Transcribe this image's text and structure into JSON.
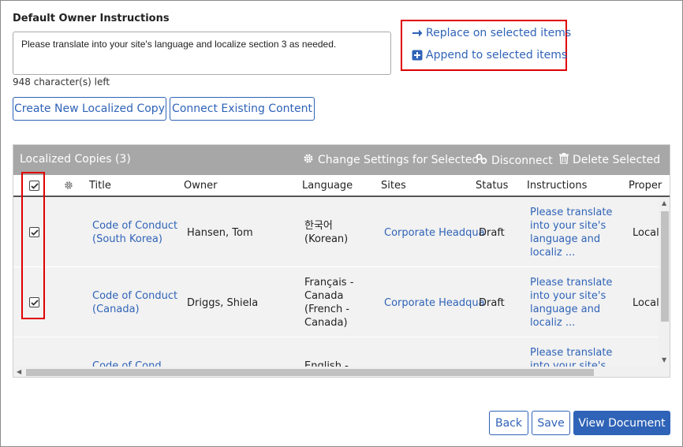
{
  "owner_instructions": {
    "label": "Default Owner Instructions",
    "value": "Please translate into your site's language and localize section 3 as needed.",
    "chars_left": "948 character(s) left"
  },
  "buttons": {
    "create_copy": "Create New Localized Copy",
    "connect_existing": "Connect Existing Content",
    "back": "Back",
    "save": "Save",
    "view_document": "View Document"
  },
  "actions": {
    "replace": "Replace on selected items",
    "append": "Append to selected items"
  },
  "grid": {
    "title": "Localized Copies (3)",
    "change_settings": "Change Settings for Selected",
    "disconnect": "Disconnect",
    "delete_selected": "Delete Selected",
    "columns": {
      "title": "Title",
      "owner": "Owner",
      "language": "Language",
      "sites": "Sites",
      "status": "Status",
      "instructions": "Instructions",
      "properties": "Proper"
    },
    "rows": [
      {
        "title_1": "Code of Conduct",
        "title_2": "(South Korea)",
        "owner": "Hansen, Tom",
        "lang_1": "한국어",
        "lang_2": "(Korean)",
        "lang_3": "",
        "lang_4": "",
        "site": "Corporate Headqua",
        "status": "Draft",
        "instr_1": "Please translate",
        "instr_2": "into your site's",
        "instr_3": "language and",
        "instr_4": "localiz ...",
        "prop": "Locali"
      },
      {
        "title_1": "Code of Conduct",
        "title_2": "(Canada)",
        "owner": "Driggs, Shiela",
        "lang_1": "Français -",
        "lang_2": "Canada",
        "lang_3": "(French -",
        "lang_4": "Canada)",
        "site": "Corporate Headqua",
        "status": "Draft",
        "instr_1": "Please translate",
        "instr_2": "into your site's",
        "instr_3": "language and",
        "instr_4": "localiz ...",
        "prop": "Locali"
      },
      {
        "title_1": "Code of Cond...",
        "instr_1": "Please translate",
        "instr_2": "into your site's",
        "lang_1": "English -"
      }
    ]
  },
  "colors": {
    "accent": "#2f63b7",
    "highlight": "#e00000",
    "grid_header": "#a7a7a7"
  }
}
